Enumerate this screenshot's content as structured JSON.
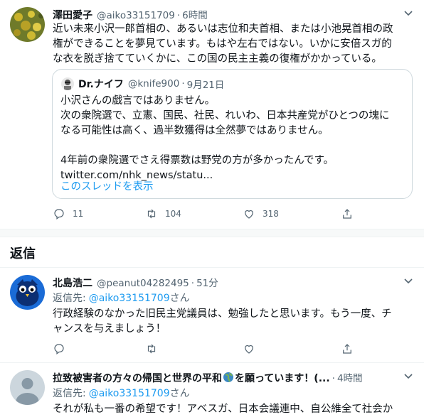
{
  "main_tweet": {
    "name": "澤田愛子",
    "handle": "@aiko33151709",
    "time": "6時間",
    "text_lines": [
      "近い未来小沢一郎首相の、あるいは志位和夫首相、または小池晃首相の政",
      "権ができることを夢見ています。もはや左右ではない。いかに安倍スガ的",
      "な衣を脱ぎ捨てていくかに、この国の民主主義の復権がかかっている。"
    ],
    "quote": {
      "name": "Dr.ナイフ",
      "handle": "@knife900",
      "date": "9月21日",
      "lines": [
        "小沢さんの戯言ではありません。",
        "次の衆院選で、立憲、国民、社民、れいわ、日本共産党がひとつの塊に",
        "なる可能性は高く、過半数獲得は全然夢ではありません。",
        "",
        "4年前の衆院選でさえ得票数は野党の方が多かったんです。",
        "twitter.com/nhk_news/statu..."
      ],
      "show_thread": "このスレッドを表示"
    },
    "reply_count": "11",
    "retweet_count": "104",
    "like_count": "318"
  },
  "replies_heading": "返信",
  "replies": [
    {
      "name": "北島浩二",
      "handle": "@peanut04282495",
      "time": "51分",
      "reply_to_prefix": "返信先:",
      "reply_to_handle": "@aiko33151709",
      "reply_to_suffix": "さん",
      "text_lines": [
        "行政経験のなかった旧民主党議員は、勉強したと思います。もう一度、チ",
        "ャンスを与えましょう！"
      ]
    },
    {
      "name": "拉致被害者の方々の帰国と世界の平和",
      "name_suffix": "を願っています！(...",
      "time": "4時間",
      "reply_to_prefix": "返信先:",
      "reply_to_handle": "@aiko33151709",
      "reply_to_suffix": "さん",
      "text_lines": [
        "それが私も一番の希望です！アベスガ、日本会議連中、自公維全て社会か"
      ]
    }
  ],
  "colors": {
    "accent": "#1d9bf0",
    "muted": "#536471",
    "border": "#cfd9de"
  },
  "icons": [
    "chevron-down-icon",
    "reply-icon",
    "retweet-icon",
    "like-icon",
    "share-icon",
    "globe-emoji-icon"
  ]
}
